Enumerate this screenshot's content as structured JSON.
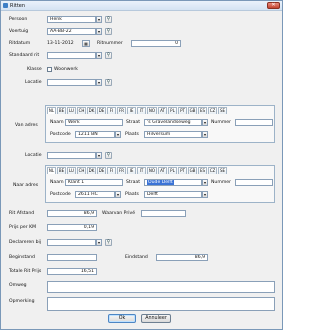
{
  "window": {
    "title": "Ritten",
    "close_label": "✕"
  },
  "form": {
    "persoon": {
      "label": "Persoon",
      "value": "Henk"
    },
    "voertuig": {
      "label": "Voertuig",
      "value": "AA-BB-22"
    },
    "ritdatum": {
      "label": "Ritdatum",
      "value": "13-11-2012"
    },
    "ritnummer": {
      "label": "Ritnummer",
      "value": "0"
    },
    "standaard_rit": {
      "label": "Standaard rit",
      "value": ""
    },
    "klasse": {
      "label": "Klasse",
      "checkbox_label": "Woonwerk"
    },
    "locatie1": {
      "label": "Locatie",
      "value": ""
    },
    "van_adres": {
      "label": "Van adres",
      "tabs": [
        "NL",
        "BE",
        "LU",
        "CH",
        "DK",
        "DE",
        "FI",
        "FR",
        "IE",
        "IT",
        "NO",
        "AT",
        "PL",
        "PT",
        "GB",
        "ES",
        "CZ",
        "SE"
      ],
      "naam_label": "Naam",
      "naam": "Werk",
      "straat_label": "Straat",
      "straat": "'s Gravelandseweg",
      "nummer_label": "Nummer",
      "nummer": "",
      "postcode_label": "Postcode",
      "postcode": "1211 BN",
      "plaats_label": "Plaats",
      "plaats": "Hilversum"
    },
    "locatie2": {
      "label": "Locatie",
      "value": ""
    },
    "naar_adres": {
      "label": "Naar adres",
      "tabs": [
        "NL",
        "BE",
        "LU",
        "CH",
        "DK",
        "DE",
        "FI",
        "FR",
        "IE",
        "IT",
        "NO",
        "AT",
        "PL",
        "PT",
        "GB",
        "ES",
        "CZ",
        "SE"
      ],
      "naam_label": "Naam",
      "naam": "Klant 1",
      "straat_label": "Straat",
      "straat": "Oude Delft",
      "nummer_label": "Nummer",
      "nummer": "",
      "postcode_label": "Postcode",
      "postcode": "2611 HC",
      "plaats_label": "Plaats",
      "plaats": "Delft"
    },
    "rit_afstand": {
      "label": "Rit Afstand",
      "value": "86,9",
      "waarvan_label": "Waarvan Privé"
    },
    "prijs_per_km": {
      "label": "Prijs per KM",
      "value": "0,19"
    },
    "declareren_bij": {
      "label": "Declareren bij",
      "value": ""
    },
    "beginstand": {
      "label": "Beginstand",
      "value": ""
    },
    "eindstand": {
      "label": "Eindstand",
      "value": "86,9"
    },
    "totale_rit_prijs": {
      "label": "Totale Rit Prijs",
      "value": "16,51"
    },
    "omweg": {
      "label": "Omweg",
      "value": ""
    },
    "opmerking": {
      "label": "Opmerking",
      "value": ""
    }
  },
  "buttons": {
    "ok": "Ok",
    "annuleer": "Annuleer"
  },
  "icons": {
    "search": "search-icon",
    "dropdown": "dropdown-arrow-icon",
    "calendar": "calendar-icon"
  },
  "colors": {
    "selection": "#3b73d6",
    "border": "#8aa0b8"
  }
}
